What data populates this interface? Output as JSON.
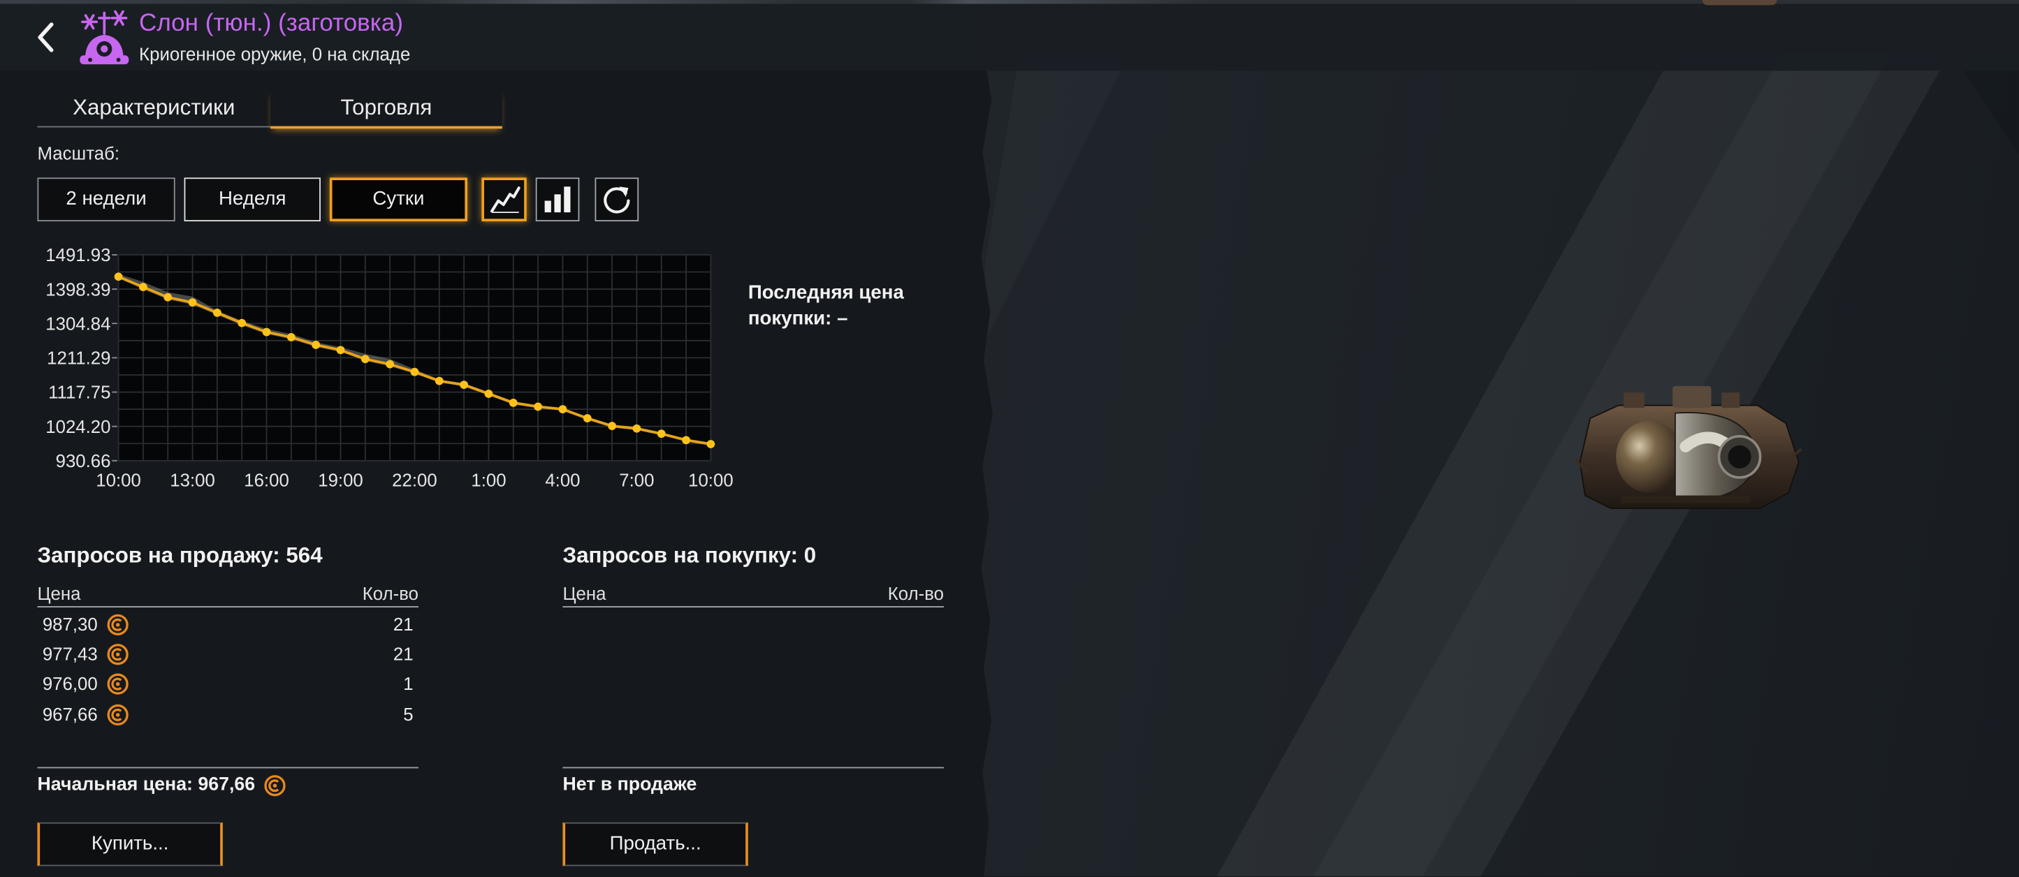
{
  "header": {
    "title": "Слон (тюн.) (заготовка)",
    "subtitle": "Криогенное оружие, 0 на складе",
    "back_icon": "chevron-left-icon",
    "item_icon": "cryo-weapon-icon"
  },
  "tabs": [
    {
      "label": "Характеристики",
      "active": false
    },
    {
      "label": "Торговля",
      "active": true
    }
  ],
  "scale": {
    "label": "Масштаб:",
    "options": [
      {
        "label": "2 недели",
        "selected": false
      },
      {
        "label": "Неделя",
        "selected": false
      },
      {
        "label": "Сутки",
        "selected": true
      }
    ],
    "view_buttons": [
      {
        "icon": "line-chart-icon",
        "selected": true
      },
      {
        "icon": "bar-chart-icon",
        "selected": false
      },
      {
        "icon": "refresh-icon",
        "selected": false
      }
    ]
  },
  "chart_data": {
    "type": "line",
    "x": [
      "10:00",
      "11:00",
      "12:00",
      "13:00",
      "14:00",
      "15:00",
      "16:00",
      "17:00",
      "18:00",
      "19:00",
      "20:00",
      "21:00",
      "22:00",
      "23:00",
      "0:00",
      "1:00",
      "2:00",
      "3:00",
      "4:00",
      "5:00",
      "6:00",
      "7:00",
      "8:00",
      "9:00",
      "10:00"
    ],
    "x_ticks": [
      "10:00",
      "13:00",
      "16:00",
      "19:00",
      "22:00",
      "1:00",
      "4:00",
      "7:00",
      "10:00"
    ],
    "y_ticks": [
      "1491.93",
      "1398.39",
      "1304.84",
      "1211.29",
      "1117.75",
      "1024.20",
      "930.66"
    ],
    "ylim": [
      930.66,
      1491.93
    ],
    "series": [
      {
        "values": [
          1432.3,
          1404.2,
          1376.2,
          1362.1,
          1334.0,
          1306.0,
          1281.4,
          1267.4,
          1246.4,
          1232.3,
          1207.8,
          1193.7,
          1172.7,
          1148.1,
          1137.6,
          1113.1,
          1088.5,
          1078.0,
          1071.0,
          1046.4,
          1025.4,
          1018.4,
          1004.3,
          986.8,
          976.0
        ]
      }
    ],
    "band": {
      "high": [
        1440,
        1418,
        1390,
        1378,
        1340,
        1312,
        1290,
        1276,
        1254,
        1240,
        1222,
        1208,
        1180,
        1152,
        1142,
        1118,
        1093,
        1082,
        1075,
        1050,
        1029,
        1022,
        1008,
        991,
        980
      ],
      "low": [
        1428,
        1398,
        1370,
        1356,
        1328,
        1300,
        1276,
        1262,
        1241,
        1227,
        1203,
        1188,
        1168,
        1144,
        1133,
        1109,
        1084,
        1074,
        1067,
        1042,
        1021,
        1014,
        1000,
        983,
        972
      ]
    },
    "grid": true,
    "legend": "none"
  },
  "last_purchase": {
    "label": "Последняя цена покупки: –"
  },
  "sell_orders": {
    "title": "Запросов на продажу: 564",
    "col_price": "Цена",
    "col_qty": "Кол-во",
    "rows": [
      {
        "price": "987,30",
        "qty": "21"
      },
      {
        "price": "977,43",
        "qty": "21"
      },
      {
        "price": "976,00",
        "qty": "1"
      },
      {
        "price": "967,66",
        "qty": "5"
      }
    ],
    "footer": "Начальная цена: 967,66",
    "button": "Купить..."
  },
  "buy_orders": {
    "title": "Запросов на покупку: 0",
    "col_price": "Цена",
    "col_qty": "Кол-во",
    "rows": [],
    "footer": "Нет в продаже",
    "button": "Продать..."
  },
  "currency_icon": "credit-coin-icon",
  "colors": {
    "accent": "#f0a020",
    "title": "#c766ef",
    "chart_line": "#e8a317",
    "chart_point": "#ffc21a",
    "coin": "#e8891e",
    "panel_bg": "#15191d"
  }
}
